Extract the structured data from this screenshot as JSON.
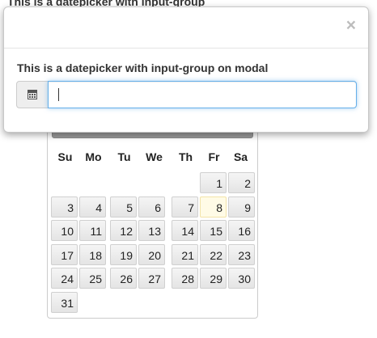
{
  "background": {
    "label": "This is a datepicker with input-group"
  },
  "modal": {
    "close_label": "×",
    "field_label": "This is a datepicker with input-group on modal",
    "input_value": "",
    "addon_icon": "calendar-icon"
  },
  "datepicker": {
    "weekdays": [
      "Su",
      "Mo",
      "Tu",
      "We",
      "Th",
      "Fr",
      "Sa"
    ],
    "days": [
      "1",
      "2",
      "3",
      "4",
      "5",
      "6",
      "7",
      "8",
      "9",
      "10",
      "11",
      "12",
      "13",
      "14",
      "15",
      "16",
      "17",
      "18",
      "19",
      "20",
      "21",
      "22",
      "23",
      "24",
      "25",
      "26",
      "27",
      "28",
      "29",
      "30",
      "31"
    ],
    "first_weekday_index": 5,
    "today": "8",
    "today_color": "#fffbe6"
  }
}
